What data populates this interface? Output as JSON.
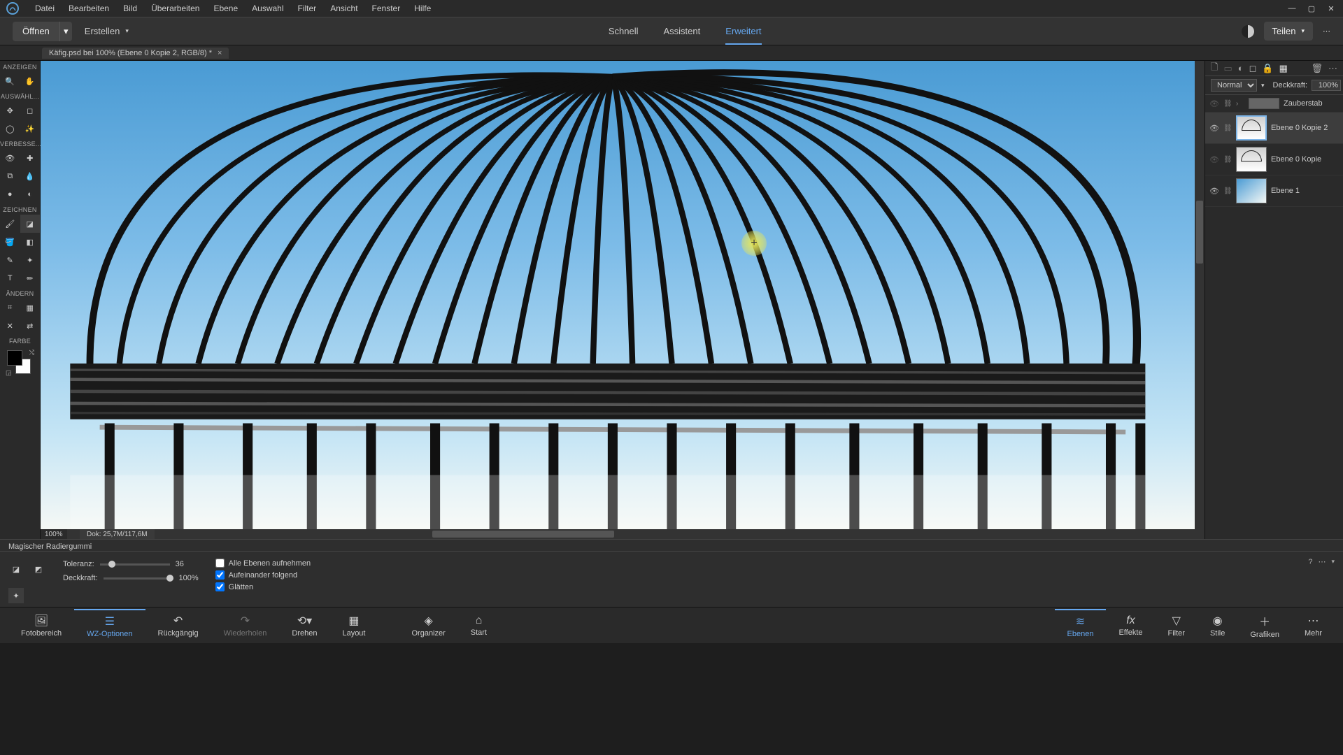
{
  "menu": {
    "datei": "Datei",
    "bearbeiten": "Bearbeiten",
    "bild": "Bild",
    "ueberarbeiten": "Überarbeiten",
    "ebene": "Ebene",
    "auswahl": "Auswahl",
    "filter": "Filter",
    "ansicht": "Ansicht",
    "fenster": "Fenster",
    "hilfe": "Hilfe"
  },
  "topbar": {
    "open_label": "Öffnen",
    "create_label": "Erstellen",
    "mode_quick": "Schnell",
    "mode_assistant": "Assistent",
    "mode_expert": "Erweitert",
    "share_label": "Teilen"
  },
  "doc_tab": {
    "title": "Käfig.psd bei 100% (Ebene 0 Kopie 2, RGB/8) *"
  },
  "toolbox": {
    "sec_view": "ANZEIGEN",
    "sec_select": "AUSWÄHL...",
    "sec_enhance": "VERBESSE...",
    "sec_draw": "ZEICHNEN",
    "sec_modify": "ÄNDERN",
    "sec_color": "FARBE"
  },
  "canvas_status": {
    "zoom": "100%",
    "doc_size": "Dok: 25,7M/117,6M"
  },
  "layers": {
    "blend_mode": "Normal",
    "opacity_label": "Deckkraft:",
    "opacity_value": "100%",
    "mask_name": "Zauberstab",
    "layer0": "Ebene 0 Kopie 2",
    "layer1": "Ebene 0 Kopie",
    "layer2": "Ebene 1"
  },
  "tool_options": {
    "tool_name": "Magischer Radiergummi",
    "tolerance_label": "Toleranz:",
    "tolerance_value": "36",
    "opacity_label": "Deckkraft:",
    "opacity_value": "100%",
    "chk_all_layers": "Alle Ebenen aufnehmen",
    "chk_contiguous": "Aufeinander folgend",
    "chk_smooth": "Glätten"
  },
  "panel_bar": {
    "foto": "Fotobereich",
    "wz": "WZ-Optionen",
    "undo": "Rückgängig",
    "redo": "Wiederholen",
    "rotate": "Drehen",
    "layout": "Layout",
    "organizer": "Organizer",
    "start": "Start",
    "ebenen": "Ebenen",
    "effekte": "Effekte",
    "filter": "Filter",
    "stile": "Stile",
    "grafiken": "Grafiken",
    "mehr": "Mehr"
  }
}
